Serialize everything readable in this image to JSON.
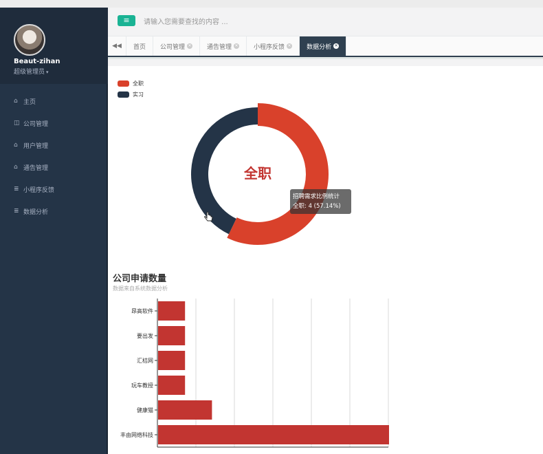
{
  "sidebar": {
    "user_name": "Beaut-zihan",
    "user_role": "超级管理员",
    "items": [
      {
        "label": "主页",
        "icon": "home-icon"
      },
      {
        "label": "公司管理",
        "icon": "columns-icon"
      },
      {
        "label": "用户管理",
        "icon": "home-icon"
      },
      {
        "label": "通告管理",
        "icon": "home-icon"
      },
      {
        "label": "小程序反馈",
        "icon": "list-icon"
      },
      {
        "label": "数据分析",
        "icon": "list-icon"
      }
    ]
  },
  "header": {
    "search_placeholder": "请输入您需要查找的内容 ..."
  },
  "tabs": [
    {
      "label": "首页",
      "closable": false,
      "active": false
    },
    {
      "label": "公司管理",
      "closable": true,
      "active": false
    },
    {
      "label": "通告管理",
      "closable": true,
      "active": false
    },
    {
      "label": "小程序反馈",
      "closable": true,
      "active": false
    },
    {
      "label": "数据分析",
      "closable": true,
      "active": true
    }
  ],
  "donut": {
    "center_label": "全职",
    "legend": [
      {
        "name": "全职",
        "color": "#d9412b"
      },
      {
        "name": "实习",
        "color": "#243447"
      }
    ],
    "tooltip_title": "招聘需求比例统计",
    "tooltip_value": "全职: 4 (57.14%)"
  },
  "bar": {
    "title": "公司申请数量",
    "subtitle": "数据来自系统数据分析"
  },
  "chart_data": [
    {
      "type": "pie",
      "title": "",
      "series": [
        {
          "name": "全职",
          "value": 4,
          "percent": 57.14,
          "color": "#d9412b"
        },
        {
          "name": "实习",
          "value": 3,
          "percent": 42.86,
          "color": "#243447"
        }
      ],
      "legend_position": "top-left"
    },
    {
      "type": "bar",
      "orientation": "horizontal",
      "title": "公司申请数量",
      "subtitle": "数据来自系统数据分析",
      "categories": [
        "丰由网络科技",
        "健康猫",
        "玩车教授",
        "汇桔网",
        "要出发",
        "昂高软件"
      ],
      "values": [
        6,
        1.4,
        0.7,
        0.7,
        0.7,
        0.7
      ],
      "xlim": [
        0,
        6
      ],
      "grid": true,
      "bar_color": "#c23531"
    }
  ]
}
